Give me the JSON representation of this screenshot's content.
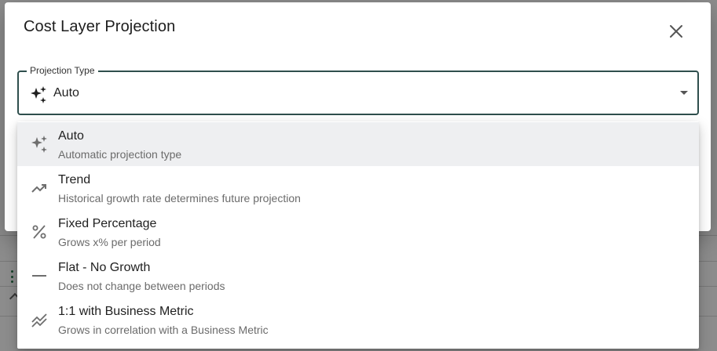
{
  "dialog": {
    "title": "Cost Layer Projection"
  },
  "select": {
    "label": "Projection Type",
    "value": "Auto",
    "icon": "sparkles-icon"
  },
  "options": [
    {
      "label": "Auto",
      "description": "Automatic projection type",
      "icon": "sparkles-icon",
      "selected": true
    },
    {
      "label": "Trend",
      "description": "Historical growth rate determines future projection",
      "icon": "trending-up-icon",
      "selected": false
    },
    {
      "label": "Fixed Percentage",
      "description": "Grows x% per period",
      "icon": "percent-icon",
      "selected": false
    },
    {
      "label": "Flat - No Growth",
      "description": "Does not change between periods",
      "icon": "dash-icon",
      "selected": false
    },
    {
      "label": "1:1 with Business Metric",
      "description": "Grows in correlation with a Business Metric",
      "icon": "correlation-icon",
      "selected": false
    }
  ],
  "colors": {
    "accent": "#2f4f4d",
    "selected_bg": "#eeeff1",
    "secondary_text": "#6b6b6b"
  }
}
